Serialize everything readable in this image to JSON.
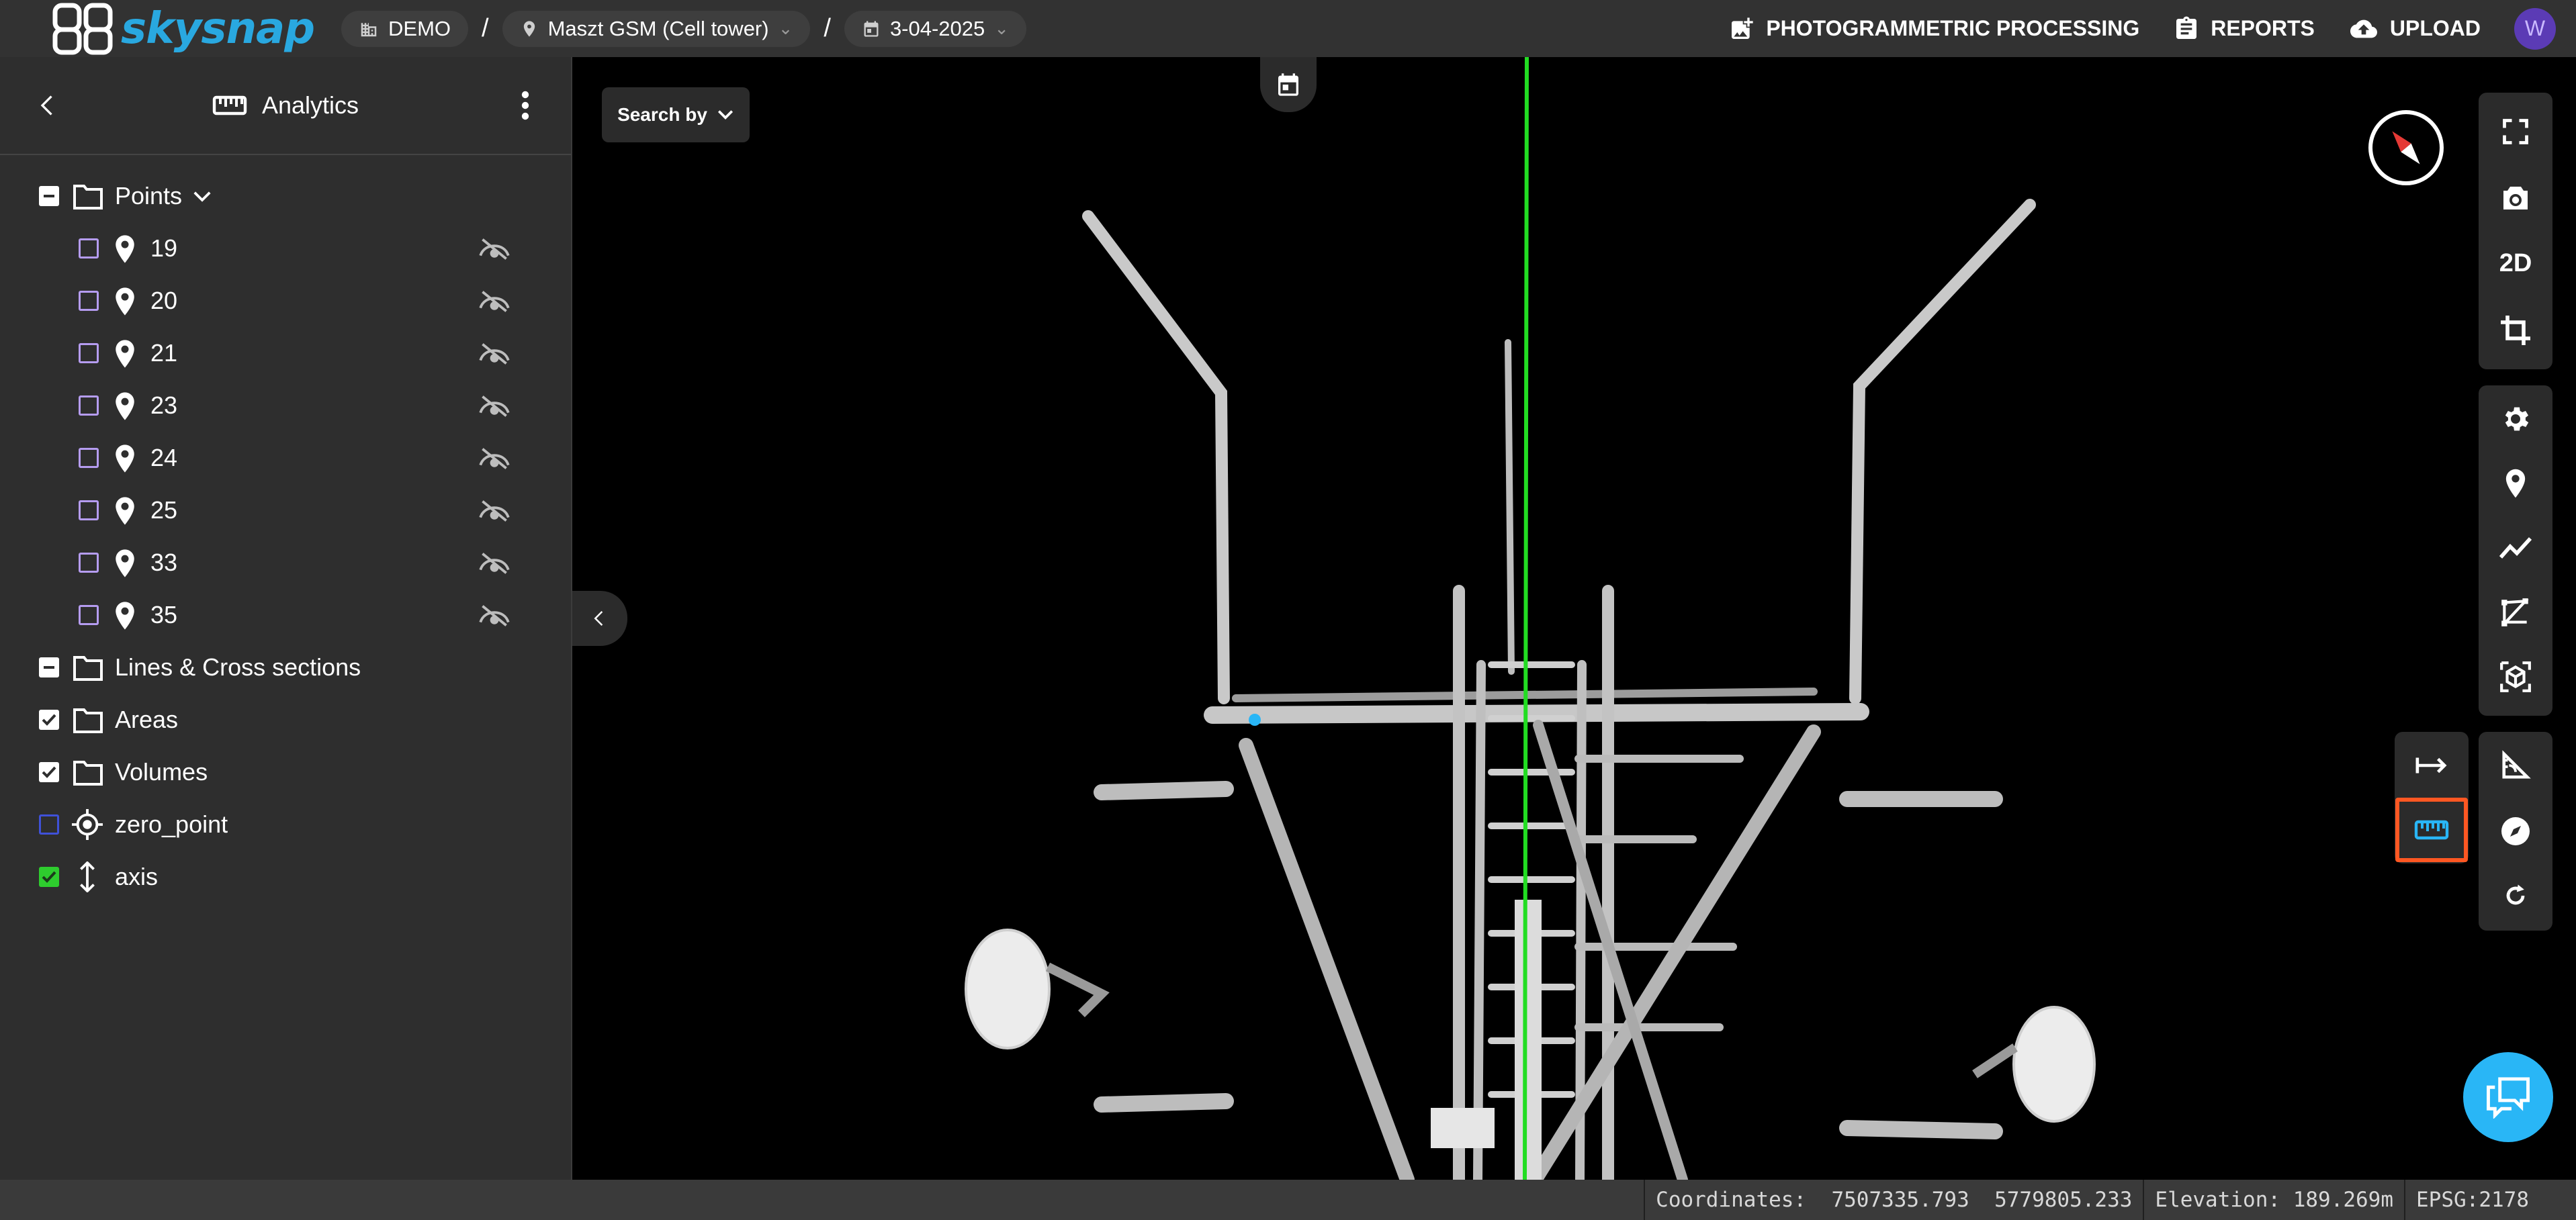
{
  "header": {
    "brand": "skysnap",
    "breadcrumbs": [
      {
        "label": "DEMO",
        "icon": "building-icon"
      },
      {
        "label": "Maszt GSM (Cell tower)",
        "icon": "location-pin-icon"
      },
      {
        "label": "3-04-2025",
        "icon": "calendar-icon"
      }
    ],
    "separator": "/",
    "actions": [
      {
        "label": "PHOTOGRAMMETRIC PROCESSING",
        "icon": "image-add-icon"
      },
      {
        "label": "REPORTS",
        "icon": "report-icon"
      },
      {
        "label": "UPLOAD",
        "icon": "cloud-upload-icon"
      }
    ],
    "avatar_initial": "W"
  },
  "sidebar": {
    "title": "Analytics",
    "points_folder": {
      "label": "Points",
      "state": "indeterminate"
    },
    "points": [
      {
        "label": "19"
      },
      {
        "label": "20"
      },
      {
        "label": "21"
      },
      {
        "label": "23"
      },
      {
        "label": "24"
      },
      {
        "label": "25"
      },
      {
        "label": "33"
      },
      {
        "label": "35"
      }
    ],
    "folders": [
      {
        "label": "Lines & Cross sections",
        "state": "indeterminate"
      },
      {
        "label": "Areas",
        "state": "checked"
      },
      {
        "label": "Volumes",
        "state": "checked"
      }
    ],
    "zero_point": {
      "label": "zero_point",
      "state": "unchecked"
    },
    "axis": {
      "label": "axis",
      "state": "checked"
    }
  },
  "viewer": {
    "search_by": "Search by",
    "toolbar_top": [
      "fullscreen-icon",
      "camera-icon",
      "2D",
      "crop-icon"
    ],
    "view_mode_label": "2D",
    "toolbar_mid": [
      "settings-icon",
      "location-pin-icon",
      "polyline-icon",
      "polygon-icon",
      "volume-cube-icon"
    ],
    "toolbar_bottom": [
      "angle-icon",
      "compass-icon",
      "rotate-icon"
    ],
    "measure_tools": [
      "distance-arrow-icon",
      "ruler-icon"
    ],
    "active_tool": "ruler-icon"
  },
  "status": {
    "coordinates_label": "Coordinates:",
    "x": "7507335.793",
    "y": "5779805.233",
    "elevation": "Elevation: 189.269m",
    "epsg": "EPSG:2178"
  },
  "colors": {
    "accent": "#29a8e0",
    "axis_line": "#22dd22",
    "highlight": "#ff5722",
    "avatar": "#5b3bb5"
  }
}
